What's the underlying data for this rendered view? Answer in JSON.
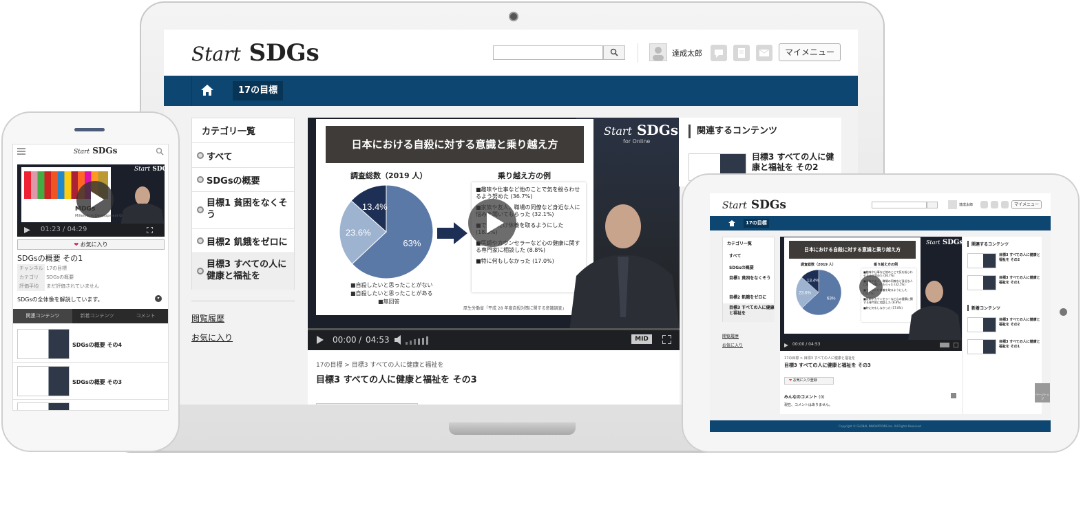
{
  "site": {
    "logo_start": "Start",
    "logo_sdgs": "SDGs"
  },
  "header": {
    "search_placeholder": "",
    "user_name": "達成太郎",
    "my_menu": "マイメニュー",
    "icons": [
      "search-icon",
      "user-avatar-icon",
      "comment-icon",
      "document-icon",
      "mail-icon"
    ]
  },
  "nav": {
    "home_icon": "home-icon",
    "active_tab": "17の目標"
  },
  "sidebar": {
    "title": "カテゴリ一覧",
    "items": [
      {
        "label": "すべて"
      },
      {
        "label": "SDGsの概要"
      },
      {
        "label": "目標1 貧困をなくそう"
      },
      {
        "label": "目標2 飢餓をゼロに"
      },
      {
        "label": "目標3 すべての人に健康と福祉を"
      }
    ],
    "links": [
      "閲覧履歴",
      "お気に入り"
    ]
  },
  "video": {
    "slide_title": "日本における自殺に対する意識と乗り越え方",
    "pie_title": "調査総数（2019 人）",
    "examples_title": "乗り越え方の例",
    "pie_slices": [
      {
        "label": "63%",
        "value": 63.0,
        "color": "#5b79a6"
      },
      {
        "label": "23.6%",
        "value": 23.6,
        "color": "#9db3cf"
      },
      {
        "label": "13.4%",
        "value": 13.4,
        "color": "#1e2f55"
      }
    ],
    "legend": [
      "■自殺したいと思ったことがない",
      "■自殺したいと思ったことがある",
      "■無回答"
    ],
    "examples": [
      "■趣味や仕事など他のことで気を紛らわせるよう努めた (36.7%)",
      "■家族や友人、職場の同僚など身近な人に悩みを聞いてもらった (32.1%)",
      "■できるだけ休養を取るようにした (18.5%)",
      "■医師やカウンセラーなど心の健康に関する専門家に相談した (8.8%)",
      "■特に何もしなかった (17.0%)"
    ],
    "source": "厚生労働省「平成 28 年度自殺対策に関する意識調査」",
    "overlay_logo_start": "Start",
    "overlay_logo_sdgs": "SDGs",
    "overlay_sub": "for Online",
    "time_current": "00:00",
    "time_sep": "/",
    "time_total": "04:53",
    "quality": "MID",
    "progress": 0.0
  },
  "content": {
    "breadcrumb_1": "17の目標",
    "breadcrumb_sep": ">",
    "breadcrumb_2": "目標3 すべての人に健康と福祉を",
    "title": "目標3 すべての人に健康と福祉を その3"
  },
  "related": {
    "title": "関連するコンテンツ",
    "items": [
      {
        "label": "目標3 すべての人に健康と福祉を その2"
      }
    ]
  },
  "tablet": {
    "related_items": [
      {
        "label": "目標3 すべての人に健康と福祉を その2",
        "time": "04:26"
      },
      {
        "label": "目標3 すべての人に健康と福祉を その1",
        "time": "02:42"
      }
    ],
    "new_title": "新着コンテンツ",
    "new_items": [
      {
        "label": "目標3 すべての人に健康と福祉を その2",
        "time": "04:26"
      },
      {
        "label": "目標3 すべての人に健康と福祉を その1",
        "time": "02:42"
      }
    ],
    "favorite_button": "お気に入り登録",
    "comments_title": "みんなのコメント",
    "comments_count": "(0)",
    "comments_empty": "現在、コメントはありません。",
    "footer": "Copyright © GLOBAL INNOVATIONS Inc. All Rights Reserved.",
    "pagetop": "ページトップ"
  },
  "phone": {
    "time_current": "01:23",
    "time_sep": "/",
    "time_total": "04:29",
    "favorite_button": "お気に入り",
    "title": "SDGsの概要 その1",
    "meta": [
      {
        "key": "チャンネル",
        "value": "17の目標"
      },
      {
        "key": "カテゴリ",
        "value": "SDGsの概要"
      },
      {
        "key": "評価平均",
        "value": "まだ評価されていません"
      }
    ],
    "description": "SDGsの全体像を解説しています。",
    "tabs": [
      "関連コンテンツ",
      "新着コンテンツ",
      "コメント"
    ],
    "list": [
      {
        "label": "SDGsの概要 その4"
      },
      {
        "label": "SDGsの概要 その3"
      }
    ],
    "video_caption": "MDGs",
    "video_caption2": "Millennium Development Goals"
  }
}
